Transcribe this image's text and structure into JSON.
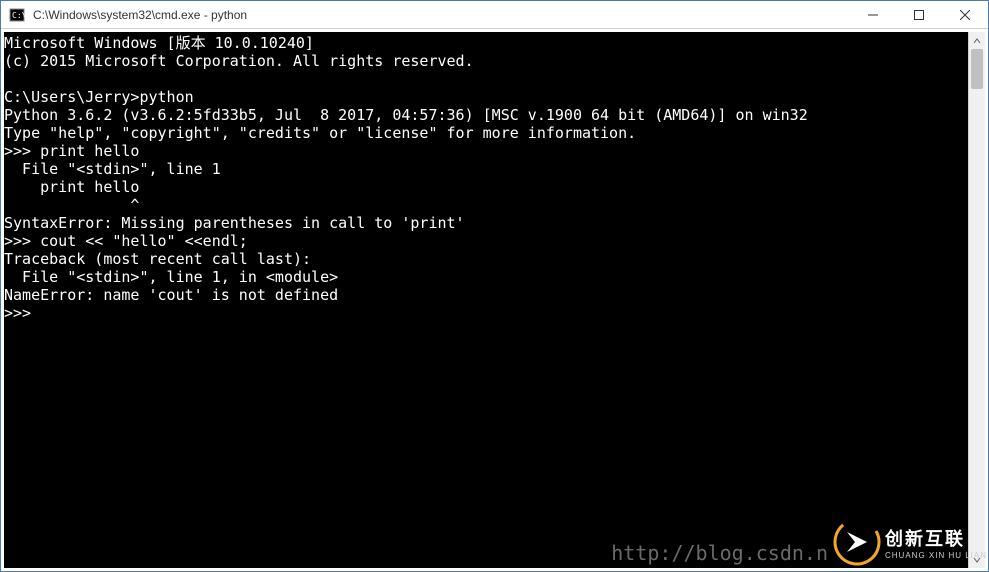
{
  "window": {
    "title": "C:\\Windows\\system32\\cmd.exe - python"
  },
  "terminal": {
    "lines": [
      "Microsoft Windows [版本 10.0.10240]",
      "(c) 2015 Microsoft Corporation. All rights reserved.",
      "",
      "C:\\Users\\Jerry>python",
      "Python 3.6.2 (v3.6.2:5fd33b5, Jul  8 2017, 04:57:36) [MSC v.1900 64 bit (AMD64)] on win32",
      "Type \"help\", \"copyright\", \"credits\" or \"license\" for more information.",
      ">>> print hello",
      "  File \"<stdin>\", line 1",
      "    print hello",
      "              ^",
      "SyntaxError: Missing parentheses in call to 'print'",
      ">>> cout << \"hello\" <<endl;",
      "Traceback (most recent call last):",
      "  File \"<stdin>\", line 1, in <module>",
      "NameError: name 'cout' is not defined",
      ">>>"
    ]
  },
  "watermark": {
    "url": "http://blog.csdn.n",
    "brand_cn": "创新互联",
    "brand_en": "CHUANG XIN HU LIAN"
  },
  "icons": {
    "app": "cmd-icon",
    "min": "minimize-icon",
    "max": "maximize-icon",
    "close": "close-icon"
  }
}
